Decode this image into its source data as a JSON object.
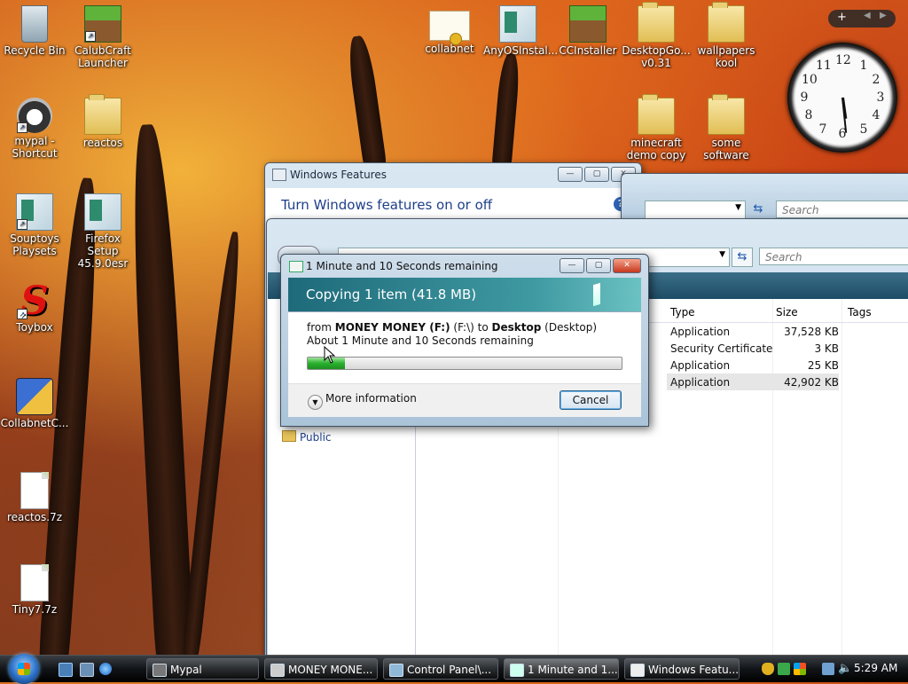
{
  "desktop": {
    "icons": [
      {
        "label": "Recycle Bin",
        "icon": "recycle-bin-icon"
      },
      {
        "label": "CalubCraft Launcher",
        "icon": "grass-block-icon"
      },
      {
        "label": "mypal - Shortcut",
        "icon": "raccoon-icon"
      },
      {
        "label": "reactos",
        "icon": "folder-icon"
      },
      {
        "label": "Souptoys Playsets",
        "icon": "installer-icon"
      },
      {
        "label": "Firefox Setup 45.9.0esr",
        "icon": "installer-icon"
      },
      {
        "label": "Toybox",
        "icon": "toybox-s-icon"
      },
      {
        "label": "CollabnetC...",
        "icon": "shield-installer-icon"
      },
      {
        "label": "reactos.7z",
        "icon": "file-icon"
      },
      {
        "label": "Tiny7.7z",
        "icon": "file-icon"
      },
      {
        "label": "collabnet",
        "icon": "certificate-icon"
      },
      {
        "label": "AnyOSInstal...",
        "icon": "installer-icon"
      },
      {
        "label": "CCInstaller",
        "icon": "grass-block-icon"
      },
      {
        "label": "DesktopGo... v0.31",
        "icon": "folder-icon"
      },
      {
        "label": "wallpapers kool",
        "icon": "folder-icon"
      },
      {
        "label": "minecraft demo copy",
        "icon": "folder-icon"
      },
      {
        "label": "some software",
        "icon": "folder-icon"
      }
    ]
  },
  "sidebar": {
    "add_label": "+",
    "clock_numbers": [
      "12",
      "1",
      "2",
      "3",
      "4",
      "5",
      "6",
      "7",
      "8",
      "9",
      "10",
      "11"
    ]
  },
  "features_window": {
    "title": "Windows Features",
    "heading": "Turn Windows features on or off",
    "help_label": "?"
  },
  "control_panel": {
    "search_placeholder": "Search"
  },
  "explorer": {
    "search_placeholder": "Search",
    "columns": [
      "Type",
      "Size",
      "Tags"
    ],
    "rows": [
      {
        "type": "Application",
        "size": "37,528 KB"
      },
      {
        "type": "Security Certificate",
        "size": "3 KB"
      },
      {
        "type": "Application",
        "size": "25 KB"
      },
      {
        "type": "Application",
        "size": "42,902 KB"
      }
    ],
    "tree_item": "Public"
  },
  "copy_dialog": {
    "title": "1 Minute and 10 Seconds remaining",
    "heading": "Copying 1 item (41.8 MB)",
    "from_label": "from",
    "source_name": "MONEY MONEY (F:)",
    "source_path": "(F:\\)",
    "to_label": "to",
    "dest_name": "Desktop",
    "dest_path": "(Desktop)",
    "remaining": "About 1 Minute and 10 Seconds remaining",
    "progress_percent": 12,
    "more_info": "More information",
    "cancel": "Cancel"
  },
  "taskbar": {
    "buttons": [
      {
        "label": "Mypal",
        "active": false
      },
      {
        "label": "MONEY MONE...",
        "active": false
      },
      {
        "label": "Control Panel\\...",
        "active": false
      },
      {
        "label": "1 Minute and 1...",
        "active": true
      },
      {
        "label": "Windows Featu...",
        "active": false
      }
    ],
    "time": "5:29 AM"
  }
}
